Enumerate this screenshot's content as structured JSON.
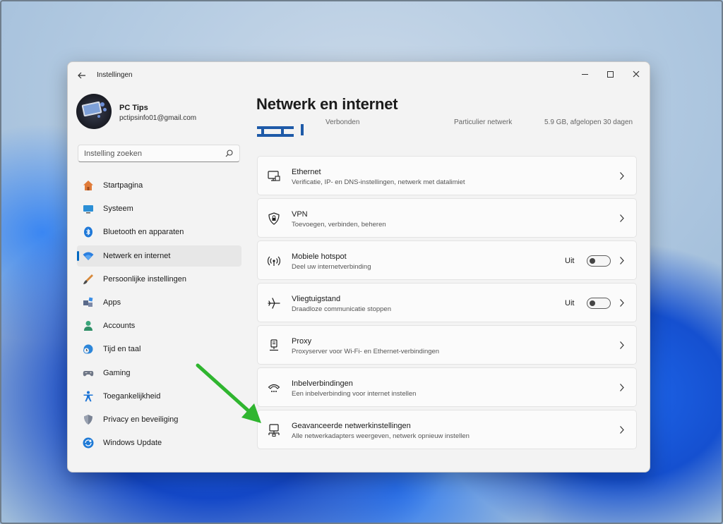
{
  "window": {
    "title": "Instellingen",
    "back_label": "←",
    "close_label": "✕"
  },
  "profile": {
    "name": "PC Tips",
    "email": "pctipsinfo01@gmail.com"
  },
  "search": {
    "placeholder": "Instelling zoeken"
  },
  "sidebar": {
    "active_index": 3,
    "accent_color": "#0067c0",
    "items": [
      {
        "label": "Startpagina",
        "icon": "home-icon"
      },
      {
        "label": "Systeem",
        "icon": "system-icon"
      },
      {
        "label": "Bluetooth en apparaten",
        "icon": "bluetooth-icon"
      },
      {
        "label": "Netwerk en internet",
        "icon": "wifi-icon"
      },
      {
        "label": "Persoonlijke instellingen",
        "icon": "brush-icon"
      },
      {
        "label": "Apps",
        "icon": "apps-icon"
      },
      {
        "label": "Accounts",
        "icon": "accounts-icon"
      },
      {
        "label": "Tijd en taal",
        "icon": "globe-clock-icon"
      },
      {
        "label": "Gaming",
        "icon": "gamepad-icon"
      },
      {
        "label": "Toegankelijkheid",
        "icon": "accessibility-icon"
      },
      {
        "label": "Privacy en beveiliging",
        "icon": "shield-icon"
      },
      {
        "label": "Windows Update",
        "icon": "update-icon"
      }
    ]
  },
  "main": {
    "title": "Netwerk en internet",
    "status_strip": {
      "connected": "Verbonden",
      "network_type": "Particulier netwerk",
      "usage": "5.9 GB, afgelopen 30 dagen"
    },
    "cards": [
      {
        "title": "Ethernet",
        "subtitle": "Verificatie, IP- en DNS-instellingen, netwerk met datalimiet",
        "icon": "ethernet-icon"
      },
      {
        "title": "VPN",
        "subtitle": "Toevoegen, verbinden, beheren",
        "icon": "vpn-shield-icon"
      },
      {
        "title": "Mobiele hotspot",
        "subtitle": "Deel uw internetverbinding",
        "icon": "hotspot-icon",
        "toggle_label": "Uit",
        "toggle_on": false
      },
      {
        "title": "Vliegtuigstand",
        "subtitle": "Draadloze communicatie stoppen",
        "icon": "airplane-icon",
        "toggle_label": "Uit",
        "toggle_on": false
      },
      {
        "title": "Proxy",
        "subtitle": "Proxyserver voor Wi-Fi- en Ethernet-verbindingen",
        "icon": "proxy-icon"
      },
      {
        "title": "Inbelverbindingen",
        "subtitle": "Een inbelverbinding voor internet instellen",
        "icon": "dialup-icon"
      },
      {
        "title": "Geavanceerde netwerkinstellingen",
        "subtitle": "Alle netwerkadapters weergeven, netwerk opnieuw instellen",
        "icon": "advanced-network-icon"
      }
    ]
  },
  "annotation": {
    "arrow_color": "#2fb52f",
    "arrow_target": "Geavanceerde netwerkinstellingen"
  }
}
